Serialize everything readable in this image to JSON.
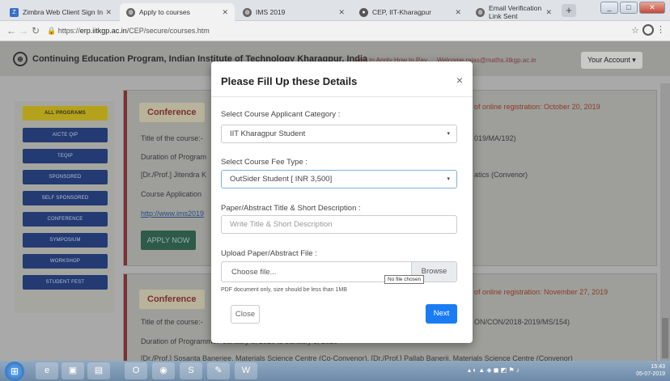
{
  "tabs": [
    {
      "label": "Zimbra Web Client Sign In",
      "icon": "zimbra-icon",
      "color": "#3a6fc6"
    },
    {
      "label": "Apply to courses",
      "icon": "globe-icon",
      "color": "#444444"
    },
    {
      "label": "IMS 2019",
      "icon": "globe-icon",
      "color": "#444444"
    },
    {
      "label": "CEP, IIT-Kharagpur",
      "icon": "iit-logo-icon",
      "color": "#444444"
    },
    {
      "label": "Email Verification Link Sent",
      "icon": "globe-icon",
      "color": "#444444"
    }
  ],
  "address": {
    "prefix": "https://",
    "domain": "erp.iitkgp.ac.in",
    "path": "/CEP/secure/courses.htm"
  },
  "site": {
    "brand": "Continuing Education Program, Indian Institute of Technology Kharagpur, India",
    "how_to": "How to Apply   How to Pay",
    "welcome": "Welcome rajas@maths.iitkgp.ac.in",
    "account": "Your Account ▾"
  },
  "sidebar": {
    "items": [
      "ALL PROGRAMS",
      "AICTE QIP",
      "TEQIP",
      "SPONSORED",
      "SELF SPONSORED",
      "CONFERENCE",
      "SYMPOSIUM",
      "WORKSHOP",
      "STUDENT FEST"
    ]
  },
  "cards": {
    "c1": {
      "badge": "Conference",
      "title": "Title of the course:-",
      "duration": "Duration of Program",
      "faculty": "[Dr./Prof.] Jitendra K",
      "app_line": "Course Application",
      "link": "http://www.ims2019",
      "reg": "of online registration: October 20, 2019",
      "code": "019/MA/192)",
      "conv": "atics (Convenor)",
      "apply": "APPLY NOW"
    },
    "c2": {
      "badge": "Conference",
      "title": "Title of the course:-",
      "reg": "of online registration: November 27, 2019",
      "code": "ON/CON/2018-2019/MS/154)",
      "duration": "Duration of Programme:- January 6, 2020 to January 8, 2020",
      "faculty": "[Dr./Prof.] Sosanta Banerjee, Materials Science Centre (Co-Convenor), [Dr./Prof.] Pallab Banerji, Materials Science Centre (Convenor)"
    }
  },
  "modal": {
    "title": "Please Fill Up these Details",
    "close_glyph": "×",
    "category_label": "Select Course Applicant Category :",
    "category_value": "IIT Kharagpur Student",
    "fee_label": "Select Course Fee Type :",
    "fee_value": "OutSider Student [ INR 3,500]",
    "paper_label": "Paper/Abstract Title & Short Description :",
    "paper_placeholder": "Write Title & Short Description",
    "upload_label": "Upload Paper/Abstract File :",
    "file_placeholder": "Choose file...",
    "browse": "Browse",
    "tooltip": "No file chosen",
    "hint": "PDF document only, size should be less than 1MB",
    "close_btn": "Close",
    "next_btn": "Next"
  },
  "taskbar": {
    "time": "15:43",
    "date": "05-07-2019"
  }
}
